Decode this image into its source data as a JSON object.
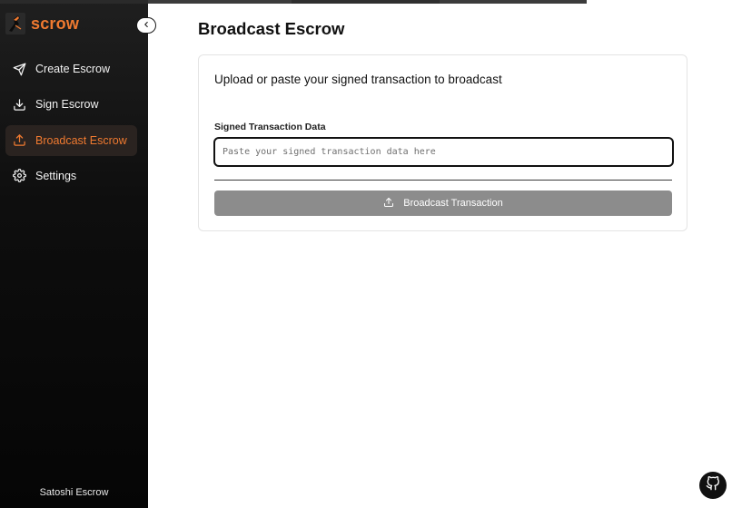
{
  "app": {
    "brand_name": "scrow",
    "brand_color": "#f07a30",
    "footer_name": "Satoshi Escrow"
  },
  "sidebar": {
    "collapse_icon": "chevron-left-icon",
    "items": [
      {
        "label": "Create Escrow",
        "icon": "send-icon",
        "active": false
      },
      {
        "label": "Sign Escrow",
        "icon": "download-icon",
        "active": false
      },
      {
        "label": "Broadcast Escrow",
        "icon": "upload-icon",
        "active": true
      },
      {
        "label": "Settings",
        "icon": "gear-icon",
        "active": false
      }
    ]
  },
  "main": {
    "title": "Broadcast Escrow",
    "card": {
      "heading": "Upload or paste your signed transaction to broadcast",
      "field_label": "Signed Transaction Data",
      "input_value": "",
      "input_placeholder": "Paste your signed transaction data here",
      "button_label": "Broadcast Transaction",
      "button_icon": "upload-icon"
    }
  },
  "floating": {
    "github_icon": "github-icon"
  }
}
